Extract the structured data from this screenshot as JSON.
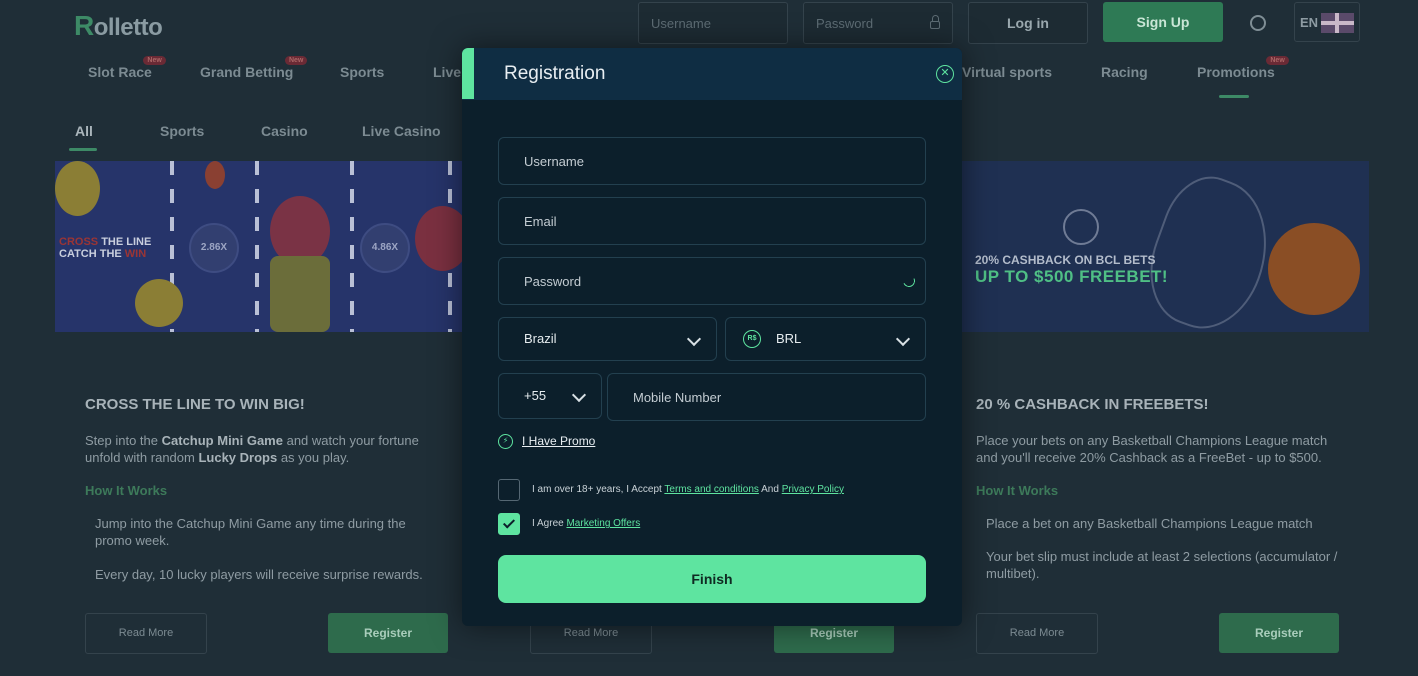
{
  "header": {
    "logo": "olletto",
    "logo_r": "R",
    "username_placeholder": "Username",
    "password_placeholder": "Password",
    "login_label": "Log in",
    "signup_label": "Sign Up",
    "lang": "EN"
  },
  "nav": {
    "items": [
      {
        "label": "Slot Race",
        "badge": "New"
      },
      {
        "label": "Grand Betting",
        "badge": "New"
      },
      {
        "label": "Sports",
        "badge": ""
      },
      {
        "label": "Live",
        "badge": ""
      },
      {
        "label": "Virtual sports",
        "badge": ""
      },
      {
        "label": "Racing",
        "badge": ""
      },
      {
        "label": "Promotions",
        "badge": "New"
      }
    ]
  },
  "subnav": {
    "items": [
      "All",
      "Sports",
      "Casino",
      "Live Casino"
    ]
  },
  "banners": {
    "left_line1_red": "CROSS",
    "left_line1": "THE LINE",
    "left_line2": "CATCH THE",
    "left_line2_red": "WIN",
    "chip1": "2.86X",
    "chip2": "4.86X",
    "right_line1": "20% CASHBACK ON BCL BETS",
    "right_line2": "UP TO $500 FREEBET!"
  },
  "cards": [
    {
      "title": "CROSS THE LINE TO WIN BIG!",
      "desc_a": "Step into the ",
      "desc_b": "Catchup Mini Game",
      "desc_c": " and watch your fortune unfold with random ",
      "desc_d": "Lucky Drops",
      "desc_e": " as you play.",
      "how": "How It Works",
      "step1": "Jump into the Catchup Mini Game any time during the promo week.",
      "step2": "Every day, 10 lucky players will receive surprise rewards.",
      "read_more": "Read More",
      "register": "Register"
    },
    {
      "read_more": "Read More",
      "register": "Register"
    },
    {
      "title": "20 % CASHBACK IN FREEBETS!",
      "desc": "Place your bets on any Basketball Champions League match and you'll receive 20% Cashback as a FreeBet - up to $500.",
      "how": "How It Works",
      "step1": "Place a bet on any Basketball Champions League match",
      "step2": "Your bet slip must include at least 2 selections (accumulator / multibet).",
      "read_more": "Read More",
      "register": "Register"
    }
  ],
  "modal": {
    "title": "Registration",
    "username_placeholder": "Username",
    "email_placeholder": "Email",
    "password_placeholder": "Password",
    "country": "Brazil",
    "currency": "BRL",
    "currency_symbol": "R$",
    "dial_code": "+55",
    "mobile_placeholder": "Mobile Number",
    "promo_label": "I Have Promo",
    "age_text_a": "I am over 18+ years, I Accept ",
    "terms_link": "Terms and conditions",
    "age_text_b": " And ",
    "privacy_link": "Privacy Policy",
    "marketing_text": "I Agree ",
    "marketing_link": "Marketing Offers",
    "age_checked": false,
    "marketing_checked": true,
    "finish_label": "Finish"
  },
  "colors": {
    "accent": "#5ee4a0",
    "modal_bg": "#0c1f2b",
    "modal_header": "#0f2d43"
  }
}
